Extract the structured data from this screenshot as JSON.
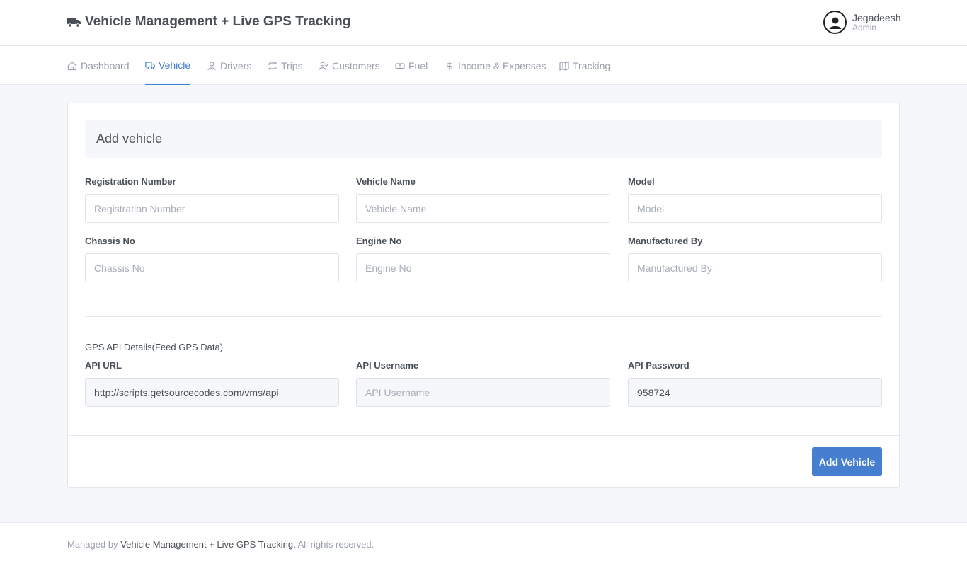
{
  "header": {
    "title": "Vehicle Management + Live GPS Tracking",
    "brand_icon": "truck-icon",
    "user": {
      "name": "Jegadeesh",
      "role": "Admin",
      "avatar_icon": "user-circle-icon"
    }
  },
  "nav": {
    "items": [
      {
        "label": "Dashboard",
        "icon": "home-icon",
        "active": false
      },
      {
        "label": "Vehicle",
        "icon": "truck-icon",
        "active": true
      },
      {
        "label": "Drivers",
        "icon": "user-icon",
        "active": false
      },
      {
        "label": "Trips",
        "icon": "repeat-icon",
        "active": false
      },
      {
        "label": "Customers",
        "icon": "user-check-icon",
        "active": false
      },
      {
        "label": "Fuel",
        "icon": "fuel-icon",
        "active": false
      },
      {
        "label": "Income & Expenses",
        "icon": "dollar-icon",
        "active": false
      },
      {
        "label": "Tracking",
        "icon": "map-icon",
        "active": false
      }
    ]
  },
  "form": {
    "title": "Add vehicle",
    "fields": {
      "registration_number": {
        "label": "Registration Number",
        "placeholder": "Registration Number",
        "value": ""
      },
      "vehicle_name": {
        "label": "Vehicle Name",
        "placeholder": "Vehicle Name",
        "value": ""
      },
      "model": {
        "label": "Model",
        "placeholder": "Model",
        "value": ""
      },
      "chassis_no": {
        "label": "Chassis No",
        "placeholder": "Chassis No",
        "value": ""
      },
      "engine_no": {
        "label": "Engine No",
        "placeholder": "Engine No",
        "value": ""
      },
      "manufactured_by": {
        "label": "Manufactured By",
        "placeholder": "Manufactured By",
        "value": ""
      }
    },
    "gps": {
      "title": "GPS API Details(Feed GPS Data)",
      "api_url": {
        "label": "API URL",
        "value": "http://scripts.getsourcecodes.com/vms/api"
      },
      "api_username": {
        "label": "API Username",
        "placeholder": "API Username",
        "value": ""
      },
      "api_password": {
        "label": "API Password",
        "value": "958724"
      }
    },
    "submit_label": "Add Vehicle"
  },
  "footer": {
    "prefix": "Managed by",
    "link": "Vehicle Management + Live GPS Tracking.",
    "suffix": "All rights reserved."
  },
  "colors": {
    "accent": "#467fcf",
    "background": "#f5f7fb",
    "text": "#495057",
    "muted": "#9aa0ac"
  }
}
